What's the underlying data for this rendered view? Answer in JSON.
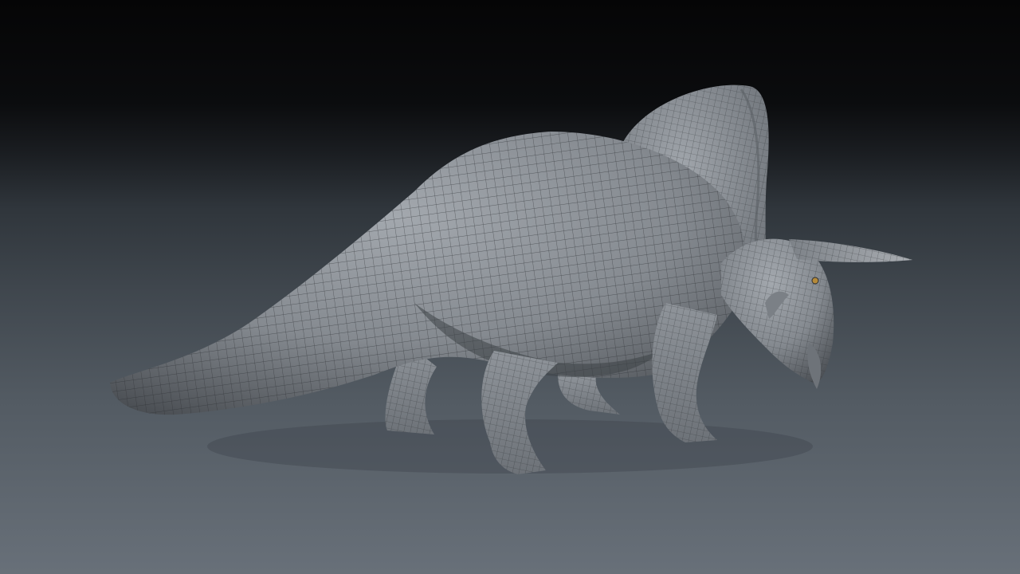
{
  "viewport": {
    "background_top": "#050506",
    "background_bottom": "#687079",
    "model": {
      "subject": "ceratopsian-dinosaur",
      "render_style": "wireframe-on-shaded",
      "surface_color": "#8a8f95",
      "wire_color": "#2a2d31"
    }
  }
}
